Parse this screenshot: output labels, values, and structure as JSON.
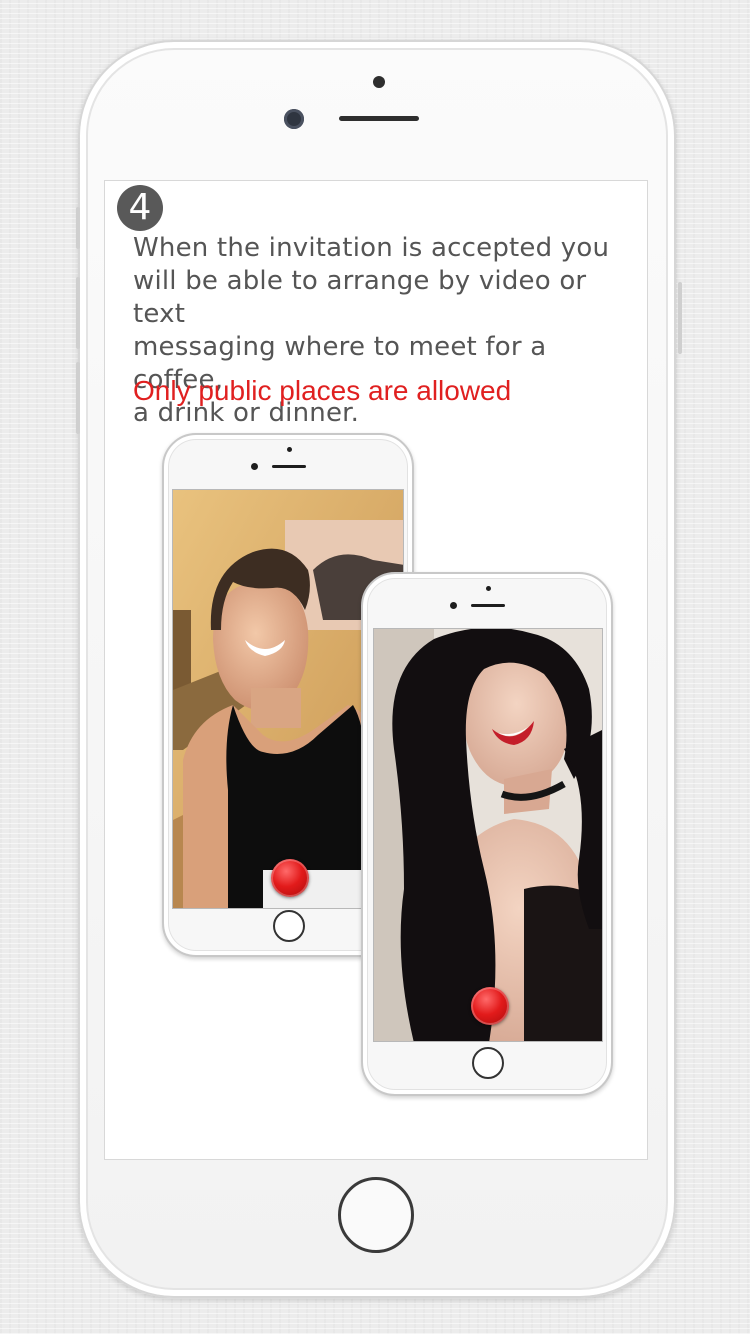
{
  "step": {
    "number": "4"
  },
  "description": {
    "lines": [
      "When the invitation is accepted you",
      "will be able to arrange by video or text",
      "messaging where to meet for a coffee,",
      "a drink or dinner."
    ]
  },
  "notice": {
    "text": "Only public places are allowed"
  },
  "colors": {
    "notice": "#e02020",
    "body_text": "#555555",
    "record_button": "#e21b1b",
    "badge": "#595959"
  },
  "icons": {
    "step_badge": "circled-number-icon",
    "record": "record-button-icon",
    "home": "home-button-icon"
  },
  "video_calls": [
    {
      "subject": "man-selfie-video"
    },
    {
      "subject": "woman-selfie-video"
    }
  ]
}
